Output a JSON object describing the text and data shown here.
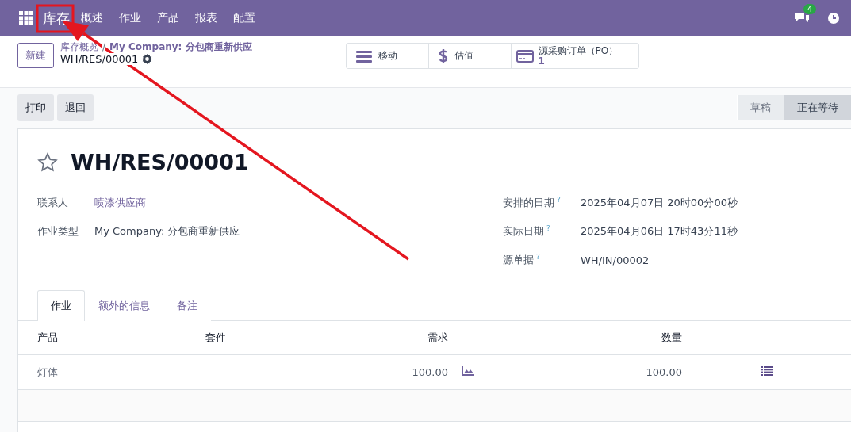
{
  "navbar": {
    "app": "库存",
    "menu": [
      "概述",
      "作业",
      "产品",
      "报表",
      "配置"
    ],
    "chat_count": "4"
  },
  "control_panel": {
    "new_button": "新建",
    "breadcrumb": [
      "库存概览",
      "My Company: 分包商重新供应"
    ],
    "breadcrumb_separator": "/",
    "record": "WH/RES/00001",
    "smart_buttons": [
      {
        "kind": "moves",
        "label": "移动"
      },
      {
        "kind": "valuation",
        "label": "估值"
      },
      {
        "kind": "po",
        "label": "源采购订单（PO）",
        "count": "1"
      }
    ]
  },
  "actions": [
    "打印",
    "退回"
  ],
  "statusbar": [
    {
      "label": "草稿",
      "selected": false
    },
    {
      "label": "正在等待",
      "selected": true
    }
  ],
  "form": {
    "title": "WH/RES/00001",
    "starred": false,
    "left_fields": [
      {
        "label": "联系人",
        "value": "喷漆供应商",
        "kind": "link"
      },
      {
        "label": "作业类型",
        "value": "My Company: 分包商重新供应",
        "kind": "text"
      }
    ],
    "right_fields": [
      {
        "label": "安排的日期",
        "help": "?",
        "value": "2025年04月07日 20时00分00秒"
      },
      {
        "label": "实际日期",
        "help": "?",
        "value": "2025年04月06日 17时43分11秒"
      },
      {
        "label": "源单据",
        "help": "?",
        "value": "WH/IN/00002"
      }
    ],
    "tabs": [
      {
        "label": "作业",
        "selected": true
      },
      {
        "label": "额外的信息",
        "selected": false
      },
      {
        "label": "备注",
        "selected": false
      }
    ],
    "table": {
      "columns": [
        "产品",
        "套件",
        "需求",
        "数量"
      ],
      "rows": [
        {
          "product": "灯体",
          "demand": "100.00",
          "quantity": "100.00"
        }
      ]
    }
  }
}
